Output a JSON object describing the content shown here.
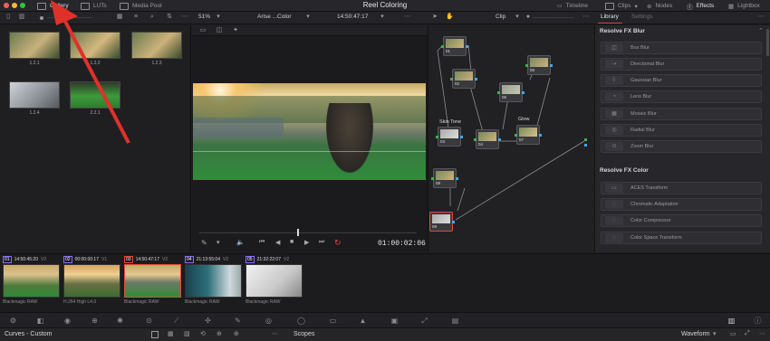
{
  "window": {
    "title": "Reel Coloring"
  },
  "top_tabs": {
    "gallery": "Gallery",
    "luts": "LUTs",
    "media_pool": "Media Pool"
  },
  "top_right": {
    "timeline": "Timeline",
    "clips": "Clips",
    "nodes": "Nodes",
    "effects": "Effects",
    "lightbox": "Lightbox"
  },
  "viewer": {
    "zoom": "51%",
    "clip_name": "Arise ...Color",
    "timecode_top": "14:50:47:17",
    "timecode": "01:00:02:06"
  },
  "node_editor": {
    "mode": "Clip"
  },
  "library": {
    "tab_library": "Library",
    "tab_settings": "Settings",
    "section_blur": "Resolve FX Blur",
    "blur_items": [
      "Box Blur",
      "Directional Blur",
      "Gaussian Blur",
      "Lens Blur",
      "Mosaic Blur",
      "Radial Blur",
      "Zoom Blur"
    ],
    "section_color": "Resolve FX Color",
    "color_items": [
      "ACES Transform",
      "Chromatic Adaptation",
      "Color Compressor",
      "Color Space Transform"
    ]
  },
  "gallery": {
    "stills": [
      "1.2.1",
      "1.2.2",
      "1.2.3",
      "1.2.4",
      "2.2.1"
    ]
  },
  "nodes": [
    {
      "id": "01",
      "label": "01"
    },
    {
      "id": "02",
      "label": "02"
    },
    {
      "id": "03",
      "label": "03",
      "title": "Skin Tone"
    },
    {
      "id": "04",
      "label": "04"
    },
    {
      "id": "05",
      "label": "05"
    },
    {
      "id": "06",
      "label": "06"
    },
    {
      "id": "07",
      "label": "07",
      "title": "Glow"
    },
    {
      "id": "08",
      "label": "08"
    },
    {
      "id": "09",
      "label": "09"
    }
  ],
  "clips": [
    {
      "num": "01",
      "tc": "14:50:45:20",
      "track": "V2",
      "codec": "Blackmagic RAW"
    },
    {
      "num": "02",
      "tc": "00:00:00:17",
      "track": "V1",
      "codec": "H.264 High L4.0"
    },
    {
      "num": "03",
      "tc": "14:50:47:17",
      "track": "V2",
      "codec": "Blackmagic RAW"
    },
    {
      "num": "04",
      "tc": "21:13:55:04",
      "track": "V2",
      "codec": "Blackmagic RAW"
    },
    {
      "num": "05",
      "tc": "21:32:22:07",
      "track": "V2",
      "codec": "Blackmagic RAW"
    }
  ],
  "bottom": {
    "left_panel": "Curves - Custom",
    "mid_panel": "Scopes",
    "scope_mode": "Waveform"
  },
  "colors": {
    "accent_red": "#e0483e",
    "node_in": "#3bb54a",
    "node_out": "#3fa9f5"
  }
}
